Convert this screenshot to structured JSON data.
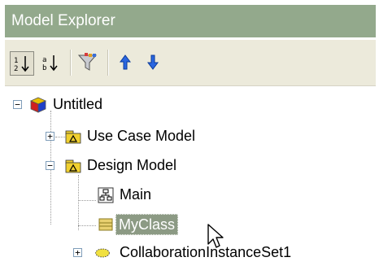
{
  "panel": {
    "title": "Model Explorer"
  },
  "toolbar": {
    "buttons": [
      {
        "name": "sort-ascending-icon",
        "pressed": true
      },
      {
        "name": "sort-descending-icon",
        "pressed": false
      },
      {
        "name": "filter-icon",
        "pressed": false
      },
      {
        "name": "move-up-icon",
        "pressed": false
      },
      {
        "name": "move-down-icon",
        "pressed": false
      }
    ]
  },
  "tree": {
    "nodes": [
      {
        "label": "Untitled",
        "icon": "project-cube-icon",
        "expander": "−",
        "expanded": true
      },
      {
        "label": "Use Case Model",
        "icon": "package-icon",
        "expander": "+",
        "expanded": false
      },
      {
        "label": "Design Model",
        "icon": "package-icon",
        "expander": "−",
        "expanded": true
      },
      {
        "label": "Main",
        "icon": "diagram-icon",
        "expander": "",
        "expanded": false
      },
      {
        "label": "MyClass",
        "icon": "class-icon",
        "expander": "",
        "expanded": false,
        "selected": true
      },
      {
        "label": "CollaborationInstanceSet1",
        "icon": "collaboration-icon",
        "expander": "+",
        "expanded": false
      }
    ]
  },
  "colors": {
    "title_bar": "#93a98c",
    "selection": "#8c9a84",
    "toolbar": "#eceadb"
  }
}
